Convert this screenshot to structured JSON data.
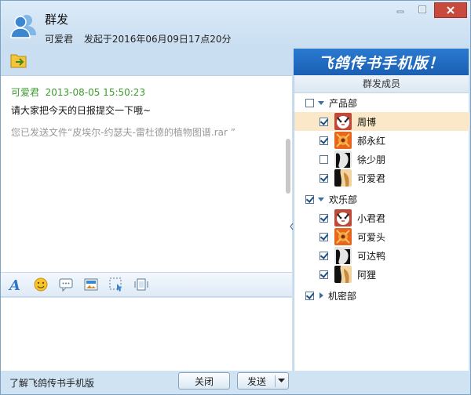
{
  "window": {
    "title": "群发",
    "sender": "可爱君",
    "started": "发起于2016年06月09日17点20分"
  },
  "chat": {
    "message": {
      "header": "可爱君  2013-08-05 15:50:23",
      "body": "请大家把今天的日报提交一下哦~",
      "file_notice": "您已发送文件“皮埃尔-约瑟夫-雷杜德的植物图谱.rar ”"
    }
  },
  "format_toolbar": {
    "icons": [
      "font-icon",
      "emoji-icon",
      "bubble-icon",
      "image-icon",
      "screenshot-icon",
      "shake-icon"
    ]
  },
  "bottom": {
    "link": "了解飞鸽传书手机版",
    "close_label": "关闭",
    "send_label": "发送"
  },
  "banner": {
    "text": "飞鸽传书手机版！"
  },
  "members_panel": {
    "title": "群发成员",
    "groups": [
      {
        "name": "产品部",
        "expanded": true,
        "checked": false,
        "members": [
          {
            "name": "周博",
            "checked": true,
            "selected": true,
            "avatar": "cat-avatar"
          },
          {
            "name": "郝永红",
            "checked": true,
            "selected": false,
            "avatar": "flower-avatar"
          },
          {
            "name": "徐少朋",
            "checked": false,
            "selected": false,
            "avatar": "bw-avatar"
          },
          {
            "name": "可爱君",
            "checked": true,
            "selected": false,
            "avatar": "tan-avatar"
          }
        ]
      },
      {
        "name": "欢乐部",
        "expanded": true,
        "checked": true,
        "members": [
          {
            "name": "小君君",
            "checked": true,
            "selected": false,
            "avatar": "cat-avatar"
          },
          {
            "name": "可爱头",
            "checked": true,
            "selected": false,
            "avatar": "flower-avatar"
          },
          {
            "name": "可达鸭",
            "checked": true,
            "selected": false,
            "avatar": "bw-avatar"
          },
          {
            "name": "阿狸",
            "checked": true,
            "selected": false,
            "avatar": "tan-avatar"
          }
        ]
      },
      {
        "name": "机密部",
        "expanded": false,
        "checked": true,
        "members": []
      }
    ]
  },
  "colors": {
    "accent": "#1a5fb3",
    "timestamp_green": "#3d9a2c",
    "selected_row": "#fbe8c8"
  }
}
